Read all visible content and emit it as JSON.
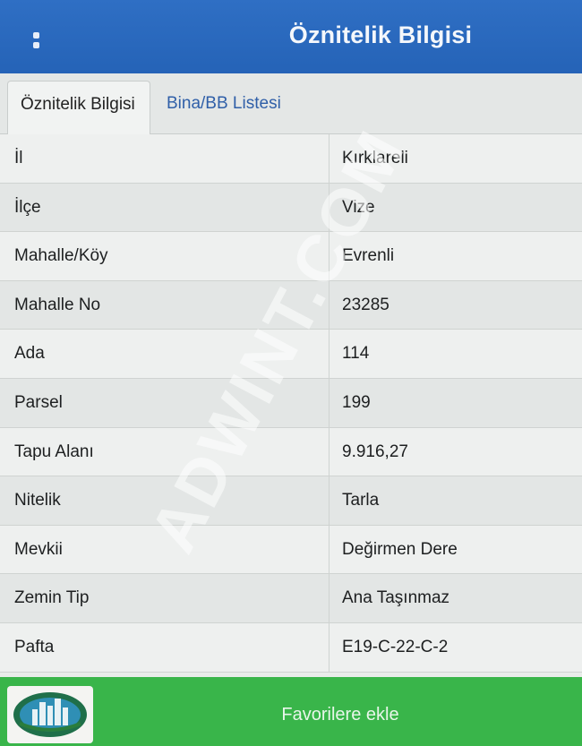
{
  "header": {
    "title": "Öznitelik Bilgisi",
    "menu_icon": "kebab-menu-icon"
  },
  "tabs": [
    {
      "label": "Öznitelik Bilgisi",
      "active": true
    },
    {
      "label": "Bina/BB Listesi",
      "active": false
    }
  ],
  "attributes": [
    {
      "label": "İl",
      "value": "Kırklareli"
    },
    {
      "label": "İlçe",
      "value": "Vize"
    },
    {
      "label": "Mahalle/Köy",
      "value": "Evrenli"
    },
    {
      "label": "Mahalle No",
      "value": "23285"
    },
    {
      "label": "Ada",
      "value": "114"
    },
    {
      "label": "Parsel",
      "value": "199"
    },
    {
      "label": "Tapu Alanı",
      "value": "9.916,27"
    },
    {
      "label": "Nitelik",
      "value": "Tarla"
    },
    {
      "label": "Mevkii",
      "value": "Değirmen Dere"
    },
    {
      "label": "Zemin Tip",
      "value": "Ana Taşınmaz"
    },
    {
      "label": "Pafta",
      "value": "E19-C-22-C-2"
    }
  ],
  "watermark": "ADWINT.COM",
  "footer": {
    "favorite_label": "Favorilere ekle"
  },
  "colors": {
    "header": "#2563b7",
    "footer": "#39b54a",
    "tab_link": "#2f5fa8"
  }
}
